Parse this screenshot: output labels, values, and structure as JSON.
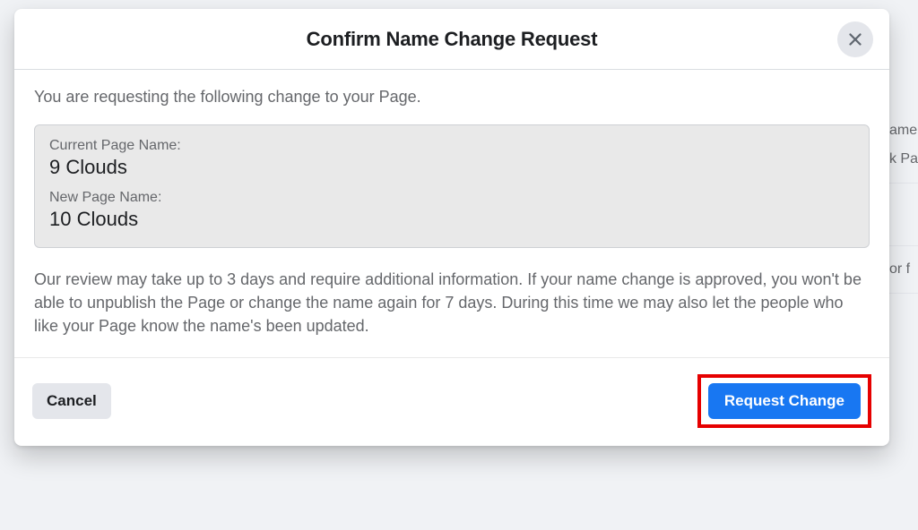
{
  "dialog": {
    "title": "Confirm Name Change Request",
    "intro": "You are requesting the following change to your Page.",
    "current_label": "Current Page Name:",
    "current_value": "9 Clouds",
    "new_label": "New Page Name:",
    "new_value": "10 Clouds",
    "review": "Our review may take up to 3 days and require additional information. If your name change is approved, you won't be able to unpublish the Page or change the name again for 7 days. During this time we may also let the people who like your Page know the name's been updated.",
    "cancel_label": "Cancel",
    "request_label": "Request Change"
  },
  "background": {
    "line1": "ame",
    "line2": "k Pa",
    "line3": "or f"
  }
}
